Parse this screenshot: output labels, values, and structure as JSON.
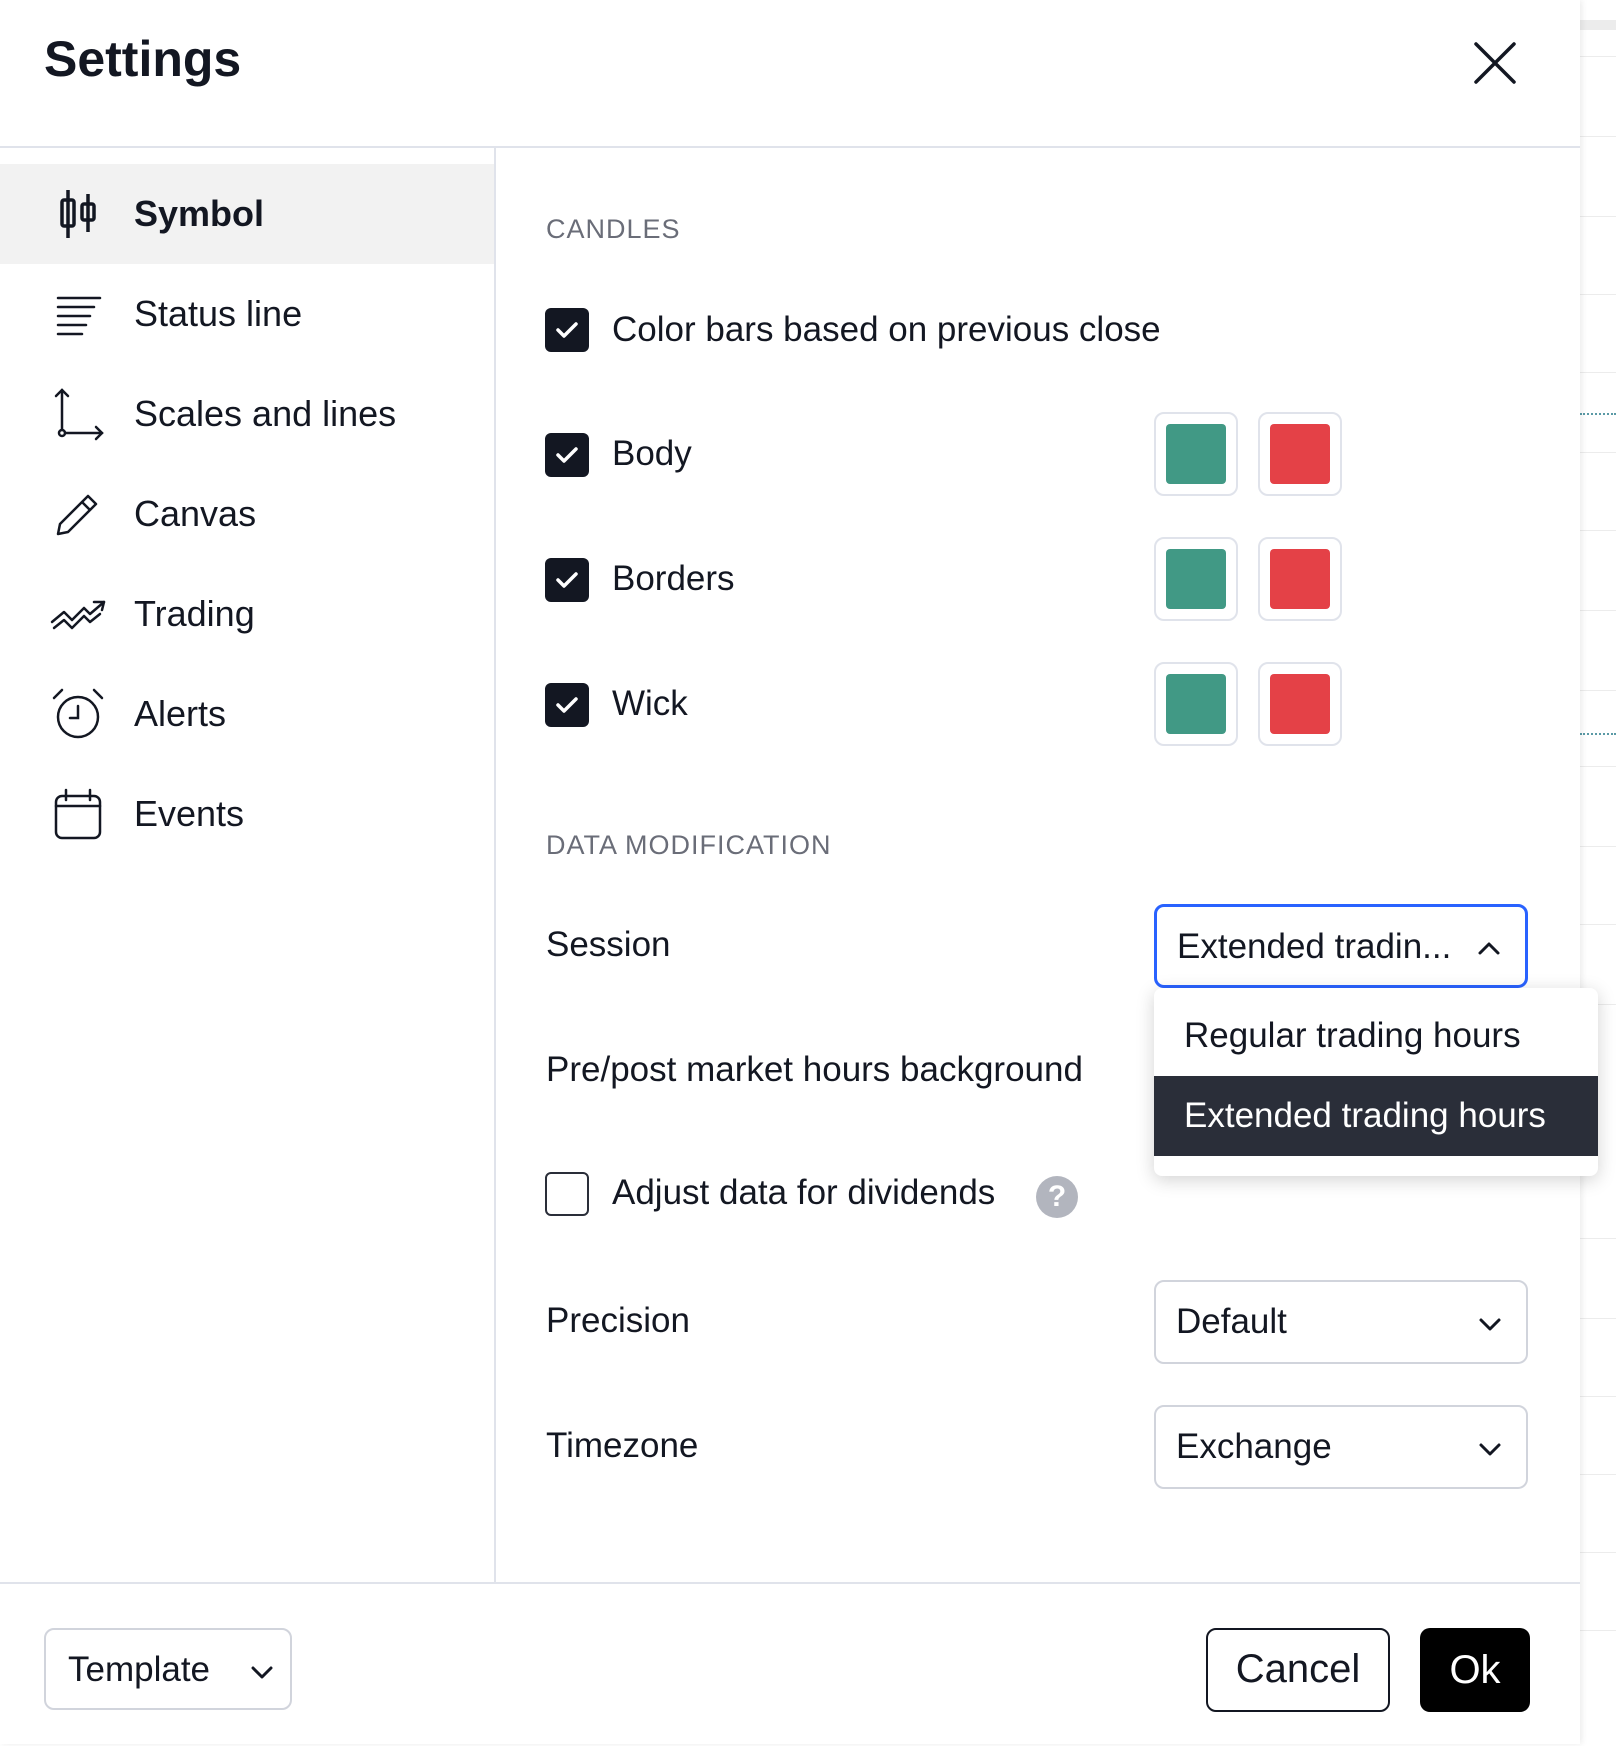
{
  "dialog": {
    "title": "Settings"
  },
  "sidebar": {
    "items": [
      {
        "label": "Symbol",
        "icon": "candles-icon",
        "active": true
      },
      {
        "label": "Status line",
        "icon": "status-line-icon"
      },
      {
        "label": "Scales and lines",
        "icon": "scales-icon"
      },
      {
        "label": "Canvas",
        "icon": "pencil-icon"
      },
      {
        "label": "Trading",
        "icon": "trading-icon"
      },
      {
        "label": "Alerts",
        "icon": "alarm-clock-icon"
      },
      {
        "label": "Events",
        "icon": "calendar-icon"
      }
    ]
  },
  "candles": {
    "section_title": "CANDLES",
    "color_bars": {
      "label": "Color bars based on previous close",
      "checked": true
    },
    "body": {
      "label": "Body",
      "checked": true,
      "up_color": "#419985",
      "down_color": "#e44147"
    },
    "borders": {
      "label": "Borders",
      "checked": true,
      "up_color": "#419985",
      "down_color": "#e44147"
    },
    "wick": {
      "label": "Wick",
      "checked": true,
      "up_color": "#419985",
      "down_color": "#e44147"
    }
  },
  "data_modification": {
    "section_title": "DATA MODIFICATION",
    "session": {
      "label": "Session",
      "value": "Extended tradin...",
      "options": [
        "Regular trading hours",
        "Extended trading hours"
      ],
      "selected_option": "Extended trading hours"
    },
    "prepost_background": {
      "label": "Pre/post market hours background"
    },
    "adjust_dividends": {
      "label": "Adjust data for dividends",
      "checked": false,
      "help_glyph": "?"
    },
    "precision": {
      "label": "Precision",
      "value": "Default"
    },
    "timezone": {
      "label": "Timezone",
      "value": "Exchange"
    }
  },
  "footer": {
    "template_label": "Template",
    "cancel_label": "Cancel",
    "ok_label": "Ok"
  },
  "colors": {
    "accent": "#2962ff",
    "up": "#419985",
    "down": "#e44147"
  }
}
